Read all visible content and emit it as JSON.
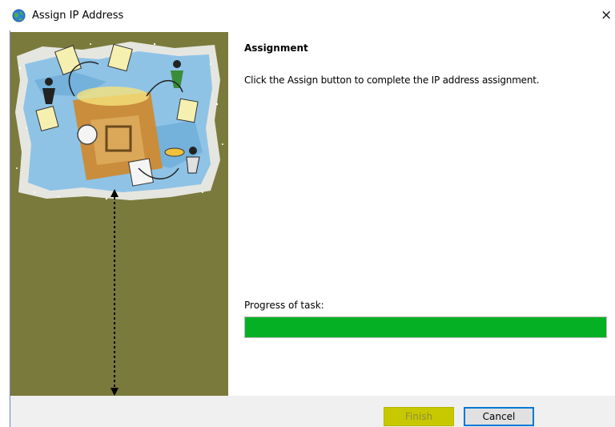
{
  "window": {
    "title": "Assign IP Address",
    "close_glyph": "×",
    "icon": "globe-network-icon"
  },
  "content": {
    "heading": "Assignment",
    "description": "Click the Assign button to complete the IP address assignment.",
    "progress_label": "Progress of task:",
    "progress_percent": 100
  },
  "buttons": {
    "finish_label": "Finish",
    "cancel_label": "Cancel"
  },
  "colors": {
    "panel_background": "#7a7a3d",
    "progress_fill": "#06b025",
    "finish_highlight": "#c8c800",
    "cancel_border": "#0078d7"
  }
}
